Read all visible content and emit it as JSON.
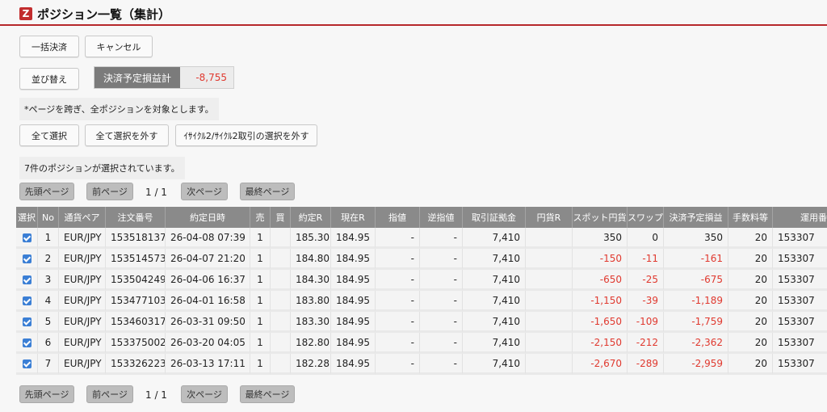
{
  "header": {
    "logo": "Z",
    "title": "ポジション一覧（集計）"
  },
  "actions": {
    "bulk_settle": "一括決済",
    "cancel": "キャンセル",
    "sort": "並び替え"
  },
  "pl_summary": {
    "label": "決済予定損益計",
    "value": "-8,755"
  },
  "note": "*ページを跨ぎ、全ポジションを対象とします。",
  "selection": {
    "select_all": "全て選択",
    "deselect_all": "全て選択を外す",
    "deselect_cycle": "ｲｻｲｸﾙ2/ｻｲｸﾙ2取引の選択を外す",
    "count_text": "7件のポジションが選択されています。"
  },
  "pager": {
    "first": "先頭ページ",
    "prev": "前ページ",
    "count": "1 / 1",
    "next": "次ページ",
    "last": "最終ページ"
  },
  "table": {
    "columns": [
      "選択",
      "No",
      "通貨ペア",
      "注文番号",
      "約定日時",
      "売",
      "買",
      "約定R",
      "現在R",
      "指値",
      "逆指値",
      "取引証拠金",
      "円貨R",
      "スポット円貨",
      "スワップ",
      "決済予定損益",
      "手数料等",
      "運用番号"
    ],
    "rows": [
      {
        "no": "1",
        "pair": "EUR/JPY",
        "order": "153518137",
        "datetime": "26-04-08 07:39",
        "sell": "1",
        "buy": "",
        "exec_rate": "185.30",
        "cur_rate": "184.95",
        "limit": "-",
        "stop": "-",
        "margin": "7,410",
        "yen_rate": "",
        "spot": "350",
        "swap": "0",
        "pl": "350",
        "fee": "20",
        "op": "153307"
      },
      {
        "no": "2",
        "pair": "EUR/JPY",
        "order": "153514573",
        "datetime": "26-04-07 21:20",
        "sell": "1",
        "buy": "",
        "exec_rate": "184.80",
        "cur_rate": "184.95",
        "limit": "-",
        "stop": "-",
        "margin": "7,410",
        "yen_rate": "",
        "spot": "-150",
        "swap": "-11",
        "pl": "-161",
        "fee": "20",
        "op": "153307"
      },
      {
        "no": "3",
        "pair": "EUR/JPY",
        "order": "153504249",
        "datetime": "26-04-06 16:37",
        "sell": "1",
        "buy": "",
        "exec_rate": "184.30",
        "cur_rate": "184.95",
        "limit": "-",
        "stop": "-",
        "margin": "7,410",
        "yen_rate": "",
        "spot": "-650",
        "swap": "-25",
        "pl": "-675",
        "fee": "20",
        "op": "153307"
      },
      {
        "no": "4",
        "pair": "EUR/JPY",
        "order": "153477103",
        "datetime": "26-04-01 16:58",
        "sell": "1",
        "buy": "",
        "exec_rate": "183.80",
        "cur_rate": "184.95",
        "limit": "-",
        "stop": "-",
        "margin": "7,410",
        "yen_rate": "",
        "spot": "-1,150",
        "swap": "-39",
        "pl": "-1,189",
        "fee": "20",
        "op": "153307"
      },
      {
        "no": "5",
        "pair": "EUR/JPY",
        "order": "153460317",
        "datetime": "26-03-31 09:50",
        "sell": "1",
        "buy": "",
        "exec_rate": "183.30",
        "cur_rate": "184.95",
        "limit": "-",
        "stop": "-",
        "margin": "7,410",
        "yen_rate": "",
        "spot": "-1,650",
        "swap": "-109",
        "pl": "-1,759",
        "fee": "20",
        "op": "153307"
      },
      {
        "no": "6",
        "pair": "EUR/JPY",
        "order": "153375002",
        "datetime": "26-03-20 04:05",
        "sell": "1",
        "buy": "",
        "exec_rate": "182.80",
        "cur_rate": "184.95",
        "limit": "-",
        "stop": "-",
        "margin": "7,410",
        "yen_rate": "",
        "spot": "-2,150",
        "swap": "-212",
        "pl": "-2,362",
        "fee": "20",
        "op": "153307"
      },
      {
        "no": "7",
        "pair": "EUR/JPY",
        "order": "153326223",
        "datetime": "26-03-13 17:11",
        "sell": "1",
        "buy": "",
        "exec_rate": "182.28",
        "cur_rate": "184.95",
        "limit": "-",
        "stop": "-",
        "margin": "7,410",
        "yen_rate": "",
        "spot": "-2,670",
        "swap": "-289",
        "pl": "-2,959",
        "fee": "20",
        "op": "153307"
      }
    ]
  },
  "colors": {
    "accent": "#b6282b",
    "negative": "#e0392f",
    "header_bg": "#8a8a8a",
    "checkbox": "#3b7fd5"
  }
}
